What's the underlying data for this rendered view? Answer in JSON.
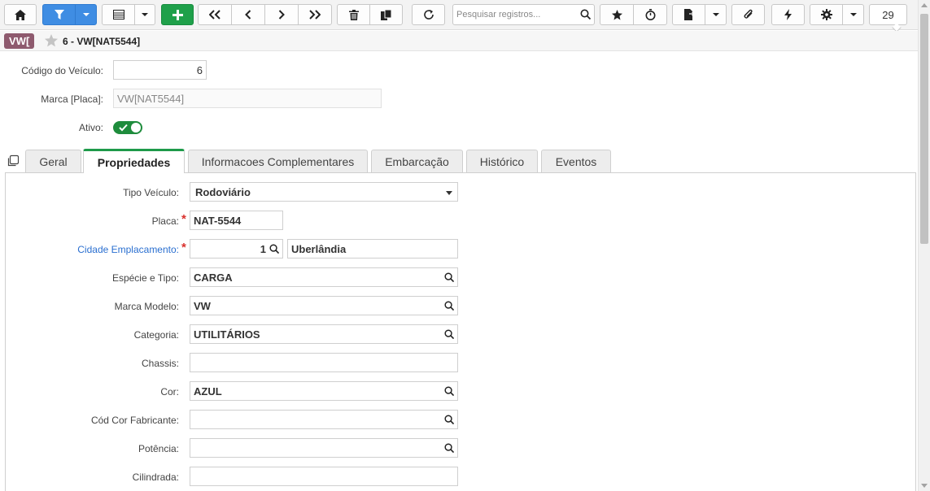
{
  "toolbar": {
    "search_placeholder": "Pesquisar registros...",
    "record_count": "29"
  },
  "record": {
    "badge": "VW[",
    "title": "6 - VW[NAT5544]"
  },
  "header_fields": {
    "codigo_label": "Código do Veículo:",
    "codigo_value": "6",
    "marca_label": "Marca [Placa]:",
    "marca_value": "VW[NAT5544]",
    "ativo_label": "Ativo:"
  },
  "tabs": [
    {
      "label": "Geral"
    },
    {
      "label": "Propriedades"
    },
    {
      "label": "Informacoes Complementares"
    },
    {
      "label": "Embarcação"
    },
    {
      "label": "Histórico"
    },
    {
      "label": "Eventos"
    }
  ],
  "fields": {
    "tipo_veiculo": {
      "label": "Tipo Veículo:",
      "value": "Rodoviário"
    },
    "placa": {
      "label": "Placa:",
      "value": "NAT-5544"
    },
    "cidade": {
      "label": "Cidade Emplacamento:",
      "code": "1",
      "name": "Uberlândia"
    },
    "especie": {
      "label": "Espécie e Tipo:",
      "value": "CARGA"
    },
    "marca_modelo": {
      "label": "Marca Modelo:",
      "value": "VW"
    },
    "categoria": {
      "label": "Categoria:",
      "value": "UTILITÁRIOS"
    },
    "chassis": {
      "label": "Chassis:",
      "value": ""
    },
    "cor": {
      "label": "Cor:",
      "value": "AZUL"
    },
    "cod_cor": {
      "label": "Cód Cor Fabricante:",
      "value": ""
    },
    "potencia": {
      "label": "Potência:",
      "value": ""
    },
    "cilindrada": {
      "label": "Cilindrada:",
      "value": ""
    }
  },
  "colors": {
    "accent_blue": "#3f8de3",
    "accent_green": "#1fa04a",
    "badge": "#8e5a6e",
    "required": "#d9302c",
    "link": "#2a6fd0"
  }
}
